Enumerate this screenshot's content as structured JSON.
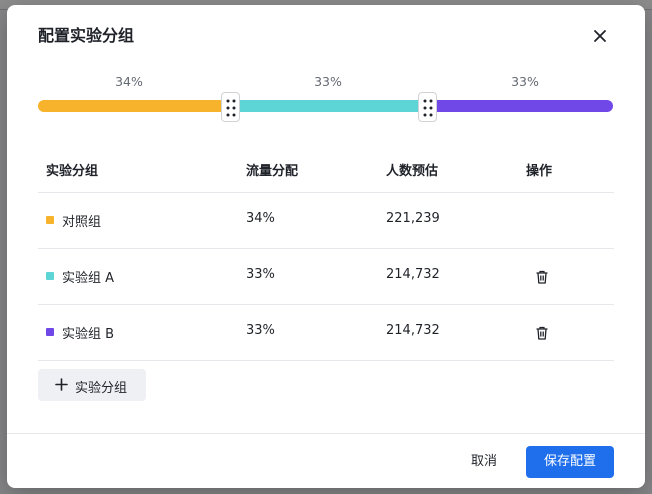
{
  "dialog": {
    "title": "配置实验分组",
    "cancel_label": "取消",
    "save_label": "保存配置",
    "add_group_label": "实验分组"
  },
  "split": {
    "labels": [
      "34%",
      "33%",
      "33%"
    ],
    "fractions": [
      0.34,
      0.33,
      0.33
    ],
    "colors": [
      "#f7b32b",
      "#5dd5d6",
      "#7048e8"
    ]
  },
  "table": {
    "headers": [
      "实验分组",
      "流量分配",
      "人数预估",
      "操作"
    ],
    "rows": [
      {
        "name": "对照组",
        "traffic": "34%",
        "estimate": "221,239",
        "color": "#f7b32b",
        "deletable": false
      },
      {
        "name": "实验组 A",
        "traffic": "33%",
        "estimate": "214,732",
        "color": "#5dd5d6",
        "deletable": true
      },
      {
        "name": "实验组 B",
        "traffic": "33%",
        "estimate": "214,732",
        "color": "#7048e8",
        "deletable": true
      }
    ]
  },
  "icons": {
    "close": "close-icon",
    "drag": "drag-handle-icon",
    "delete": "trash-icon",
    "add": "plus-icon"
  },
  "colors": {
    "primary": "#1f6fed"
  }
}
